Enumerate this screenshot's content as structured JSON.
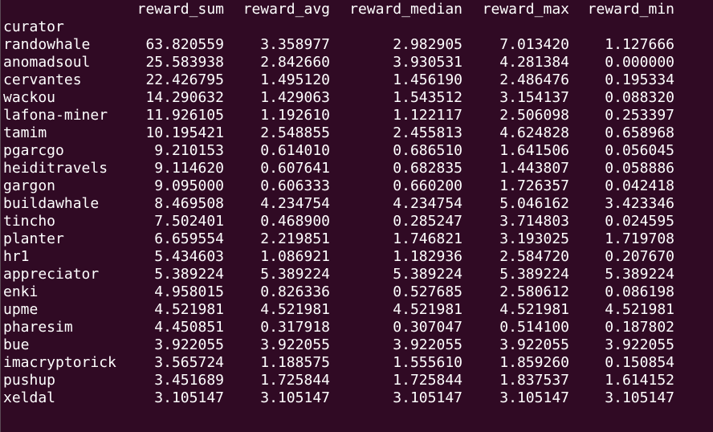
{
  "window": {
    "background": "#300a24",
    "foreground": "#ffffff"
  },
  "header": {
    "columns": [
      "reward_sum",
      "reward_avg",
      "reward_median",
      "reward_max",
      "reward_min"
    ]
  },
  "index_name": "curator",
  "rows": [
    {
      "curator": "randowhale",
      "reward_sum": "63.820559",
      "reward_avg": "3.358977",
      "reward_median": "2.982905",
      "reward_max": "7.013420",
      "reward_min": "1.127666"
    },
    {
      "curator": "anomadsoul",
      "reward_sum": "25.583938",
      "reward_avg": "2.842660",
      "reward_median": "3.930531",
      "reward_max": "4.281384",
      "reward_min": "0.000000"
    },
    {
      "curator": "cervantes",
      "reward_sum": "22.426795",
      "reward_avg": "1.495120",
      "reward_median": "1.456190",
      "reward_max": "2.486476",
      "reward_min": "0.195334"
    },
    {
      "curator": "wackou",
      "reward_sum": "14.290632",
      "reward_avg": "1.429063",
      "reward_median": "1.543512",
      "reward_max": "3.154137",
      "reward_min": "0.088320"
    },
    {
      "curator": "lafona-miner",
      "reward_sum": "11.926105",
      "reward_avg": "1.192610",
      "reward_median": "1.122117",
      "reward_max": "2.506098",
      "reward_min": "0.253397"
    },
    {
      "curator": "tamim",
      "reward_sum": "10.195421",
      "reward_avg": "2.548855",
      "reward_median": "2.455813",
      "reward_max": "4.624828",
      "reward_min": "0.658968"
    },
    {
      "curator": "pgarcgo",
      "reward_sum": "9.210153",
      "reward_avg": "0.614010",
      "reward_median": "0.686510",
      "reward_max": "1.641506",
      "reward_min": "0.056045"
    },
    {
      "curator": "heiditravels",
      "reward_sum": "9.114620",
      "reward_avg": "0.607641",
      "reward_median": "0.682835",
      "reward_max": "1.443807",
      "reward_min": "0.058886"
    },
    {
      "curator": "gargon",
      "reward_sum": "9.095000",
      "reward_avg": "0.606333",
      "reward_median": "0.660200",
      "reward_max": "1.726357",
      "reward_min": "0.042418"
    },
    {
      "curator": "buildawhale",
      "reward_sum": "8.469508",
      "reward_avg": "4.234754",
      "reward_median": "4.234754",
      "reward_max": "5.046162",
      "reward_min": "3.423346"
    },
    {
      "curator": "tincho",
      "reward_sum": "7.502401",
      "reward_avg": "0.468900",
      "reward_median": "0.285247",
      "reward_max": "3.714803",
      "reward_min": "0.024595"
    },
    {
      "curator": "planter",
      "reward_sum": "6.659554",
      "reward_avg": "2.219851",
      "reward_median": "1.746821",
      "reward_max": "3.193025",
      "reward_min": "1.719708"
    },
    {
      "curator": "hr1",
      "reward_sum": "5.434603",
      "reward_avg": "1.086921",
      "reward_median": "1.182936",
      "reward_max": "2.584720",
      "reward_min": "0.207670"
    },
    {
      "curator": "appreciator",
      "reward_sum": "5.389224",
      "reward_avg": "5.389224",
      "reward_median": "5.389224",
      "reward_max": "5.389224",
      "reward_min": "5.389224"
    },
    {
      "curator": "enki",
      "reward_sum": "4.958015",
      "reward_avg": "0.826336",
      "reward_median": "0.527685",
      "reward_max": "2.580612",
      "reward_min": "0.086198"
    },
    {
      "curator": "upme",
      "reward_sum": "4.521981",
      "reward_avg": "4.521981",
      "reward_median": "4.521981",
      "reward_max": "4.521981",
      "reward_min": "4.521981"
    },
    {
      "curator": "pharesim",
      "reward_sum": "4.450851",
      "reward_avg": "0.317918",
      "reward_median": "0.307047",
      "reward_max": "0.514100",
      "reward_min": "0.187802"
    },
    {
      "curator": "bue",
      "reward_sum": "3.922055",
      "reward_avg": "3.922055",
      "reward_median": "3.922055",
      "reward_max": "3.922055",
      "reward_min": "3.922055"
    },
    {
      "curator": "imacryptorick",
      "reward_sum": "3.565724",
      "reward_avg": "1.188575",
      "reward_median": "1.555610",
      "reward_max": "1.859260",
      "reward_min": "0.150854"
    },
    {
      "curator": "pushup",
      "reward_sum": "3.451689",
      "reward_avg": "1.725844",
      "reward_median": "1.725844",
      "reward_max": "1.837537",
      "reward_min": "1.614152"
    },
    {
      "curator": "xeldal",
      "reward_sum": "3.105147",
      "reward_avg": "3.105147",
      "reward_median": "3.105147",
      "reward_max": "3.105147",
      "reward_min": "3.105147"
    }
  ]
}
